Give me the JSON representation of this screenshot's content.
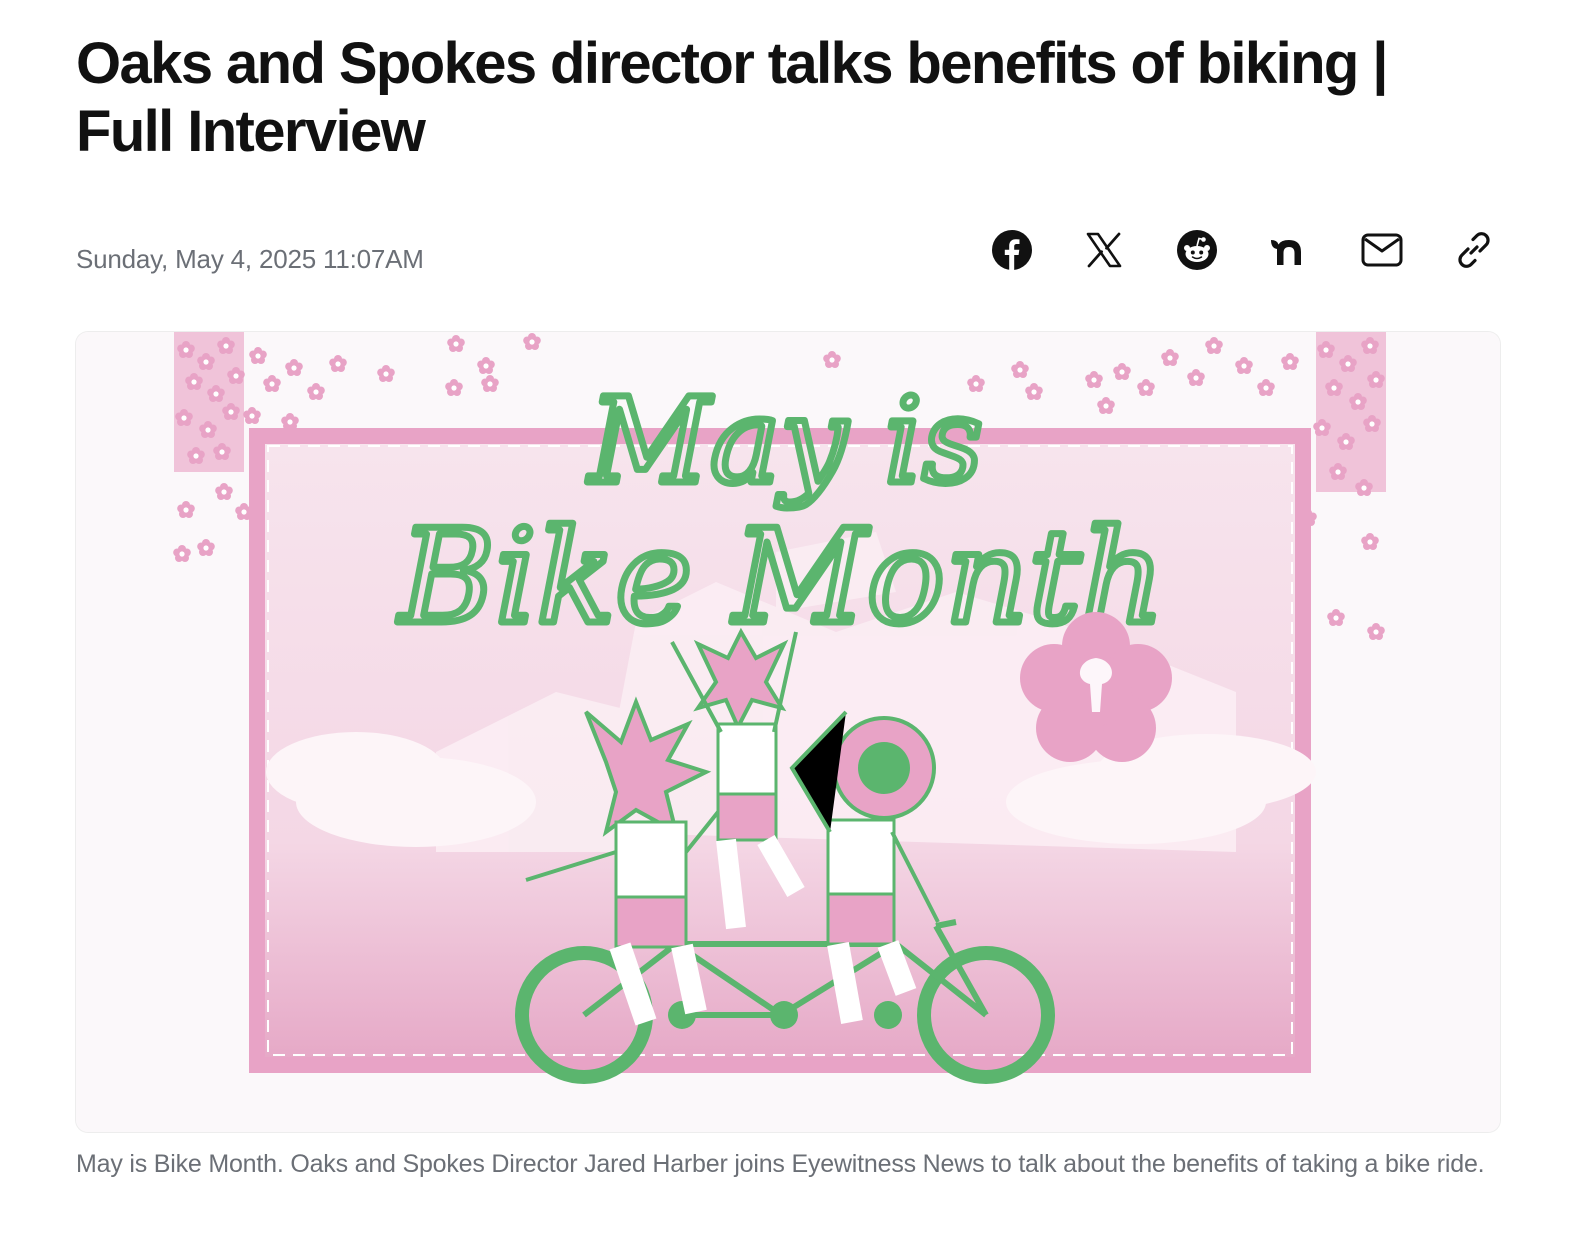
{
  "article": {
    "title": "Oaks and Spokes director talks benefits of biking | Full Interview",
    "date": "Sunday, May 4, 2025 11:07AM",
    "caption": "May is Bike Month. Oaks and Spokes Director Jared Harber joins Eyewitness News to talk about the benefits of taking a bike ride."
  },
  "share": {
    "buttons": [
      {
        "name": "facebook",
        "icon": "facebook-icon"
      },
      {
        "name": "x",
        "icon": "x-icon"
      },
      {
        "name": "reddit",
        "icon": "reddit-icon"
      },
      {
        "name": "nextdoor",
        "icon": "nextdoor-icon"
      },
      {
        "name": "email",
        "icon": "email-icon"
      },
      {
        "name": "copy-link",
        "icon": "link-icon"
      }
    ]
  },
  "video": {
    "title_line1": "May is",
    "title_line2": "Bike Month",
    "colors": {
      "pink": "#e8a3c6",
      "light_pink": "#f6d9e6",
      "green": "#5bb56e",
      "background": "#fbf8fa"
    }
  }
}
